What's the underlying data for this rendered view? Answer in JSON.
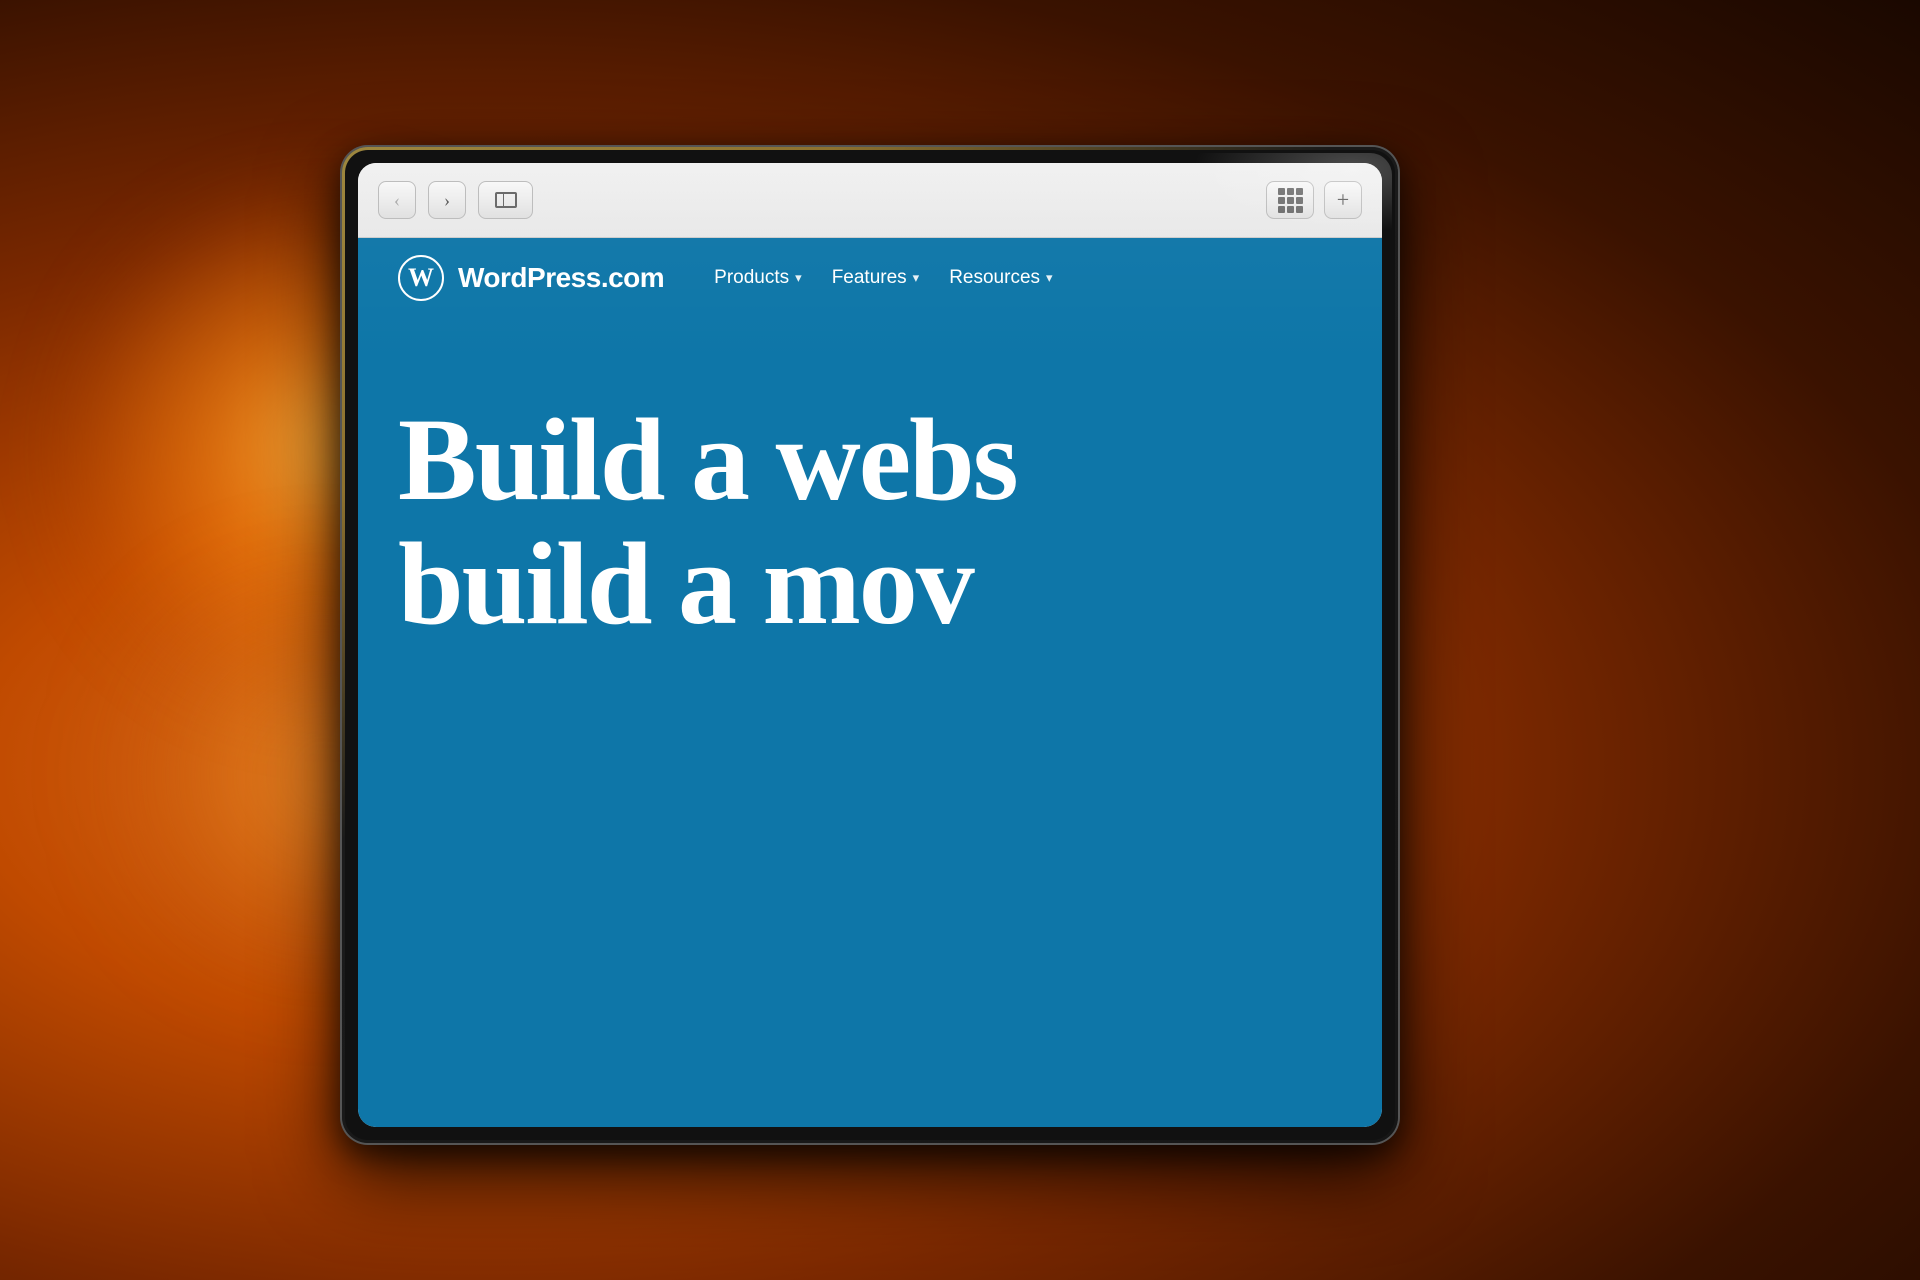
{
  "background": {
    "description": "warm bokeh background with orange/amber light"
  },
  "browser": {
    "back_button": "‹",
    "forward_button": "›",
    "grid_btn_label": "grid",
    "plus_btn_label": "+"
  },
  "website": {
    "logo_icon": "W",
    "logo_text": "WordPress.com",
    "nav_items": [
      {
        "label": "Products",
        "has_arrow": true
      },
      {
        "label": "Features",
        "has_arrow": true
      },
      {
        "label": "Resources",
        "has_arrow": true
      }
    ],
    "hero_line1": "Build a webs",
    "hero_line2": "build a mov"
  }
}
